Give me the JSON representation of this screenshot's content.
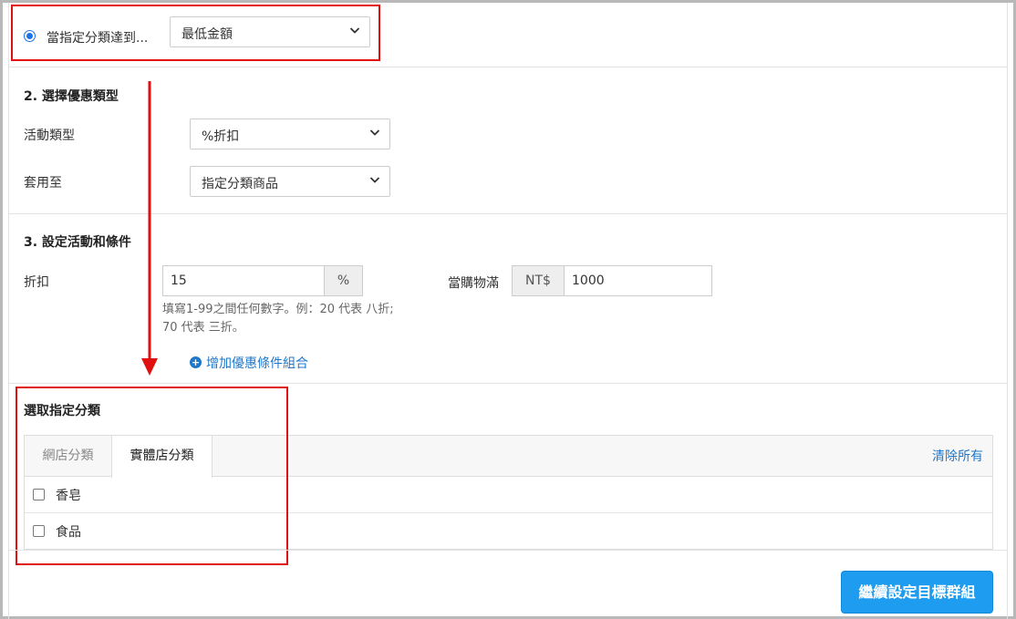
{
  "condition": {
    "radio_label": "當指定分類達到...",
    "select_value": "最低金額"
  },
  "section2": {
    "title": "2. 選擇優惠類型",
    "activity_type_label": "活動類型",
    "activity_type_value": "%折扣",
    "apply_to_label": "套用至",
    "apply_to_value": "指定分類商品"
  },
  "section3": {
    "title": "3. 設定活動和條件",
    "discount_label": "折扣",
    "discount_value": "15",
    "discount_unit": "%",
    "hint_line1": "填寫1-99之間任何數字。例：20 代表 八折;",
    "hint_line2": "70 代表 三折。",
    "threshold_label": "當購物滿",
    "currency": "NT$",
    "threshold_value": "1000",
    "add_condition_link": "增加優惠條件組合"
  },
  "category": {
    "title": "選取指定分類",
    "tabs": [
      "網店分類",
      "實體店分類"
    ],
    "clear_all": "清除所有",
    "items": [
      "香皂",
      "食品"
    ]
  },
  "footer": {
    "continue_button": "繼續設定目標群組"
  },
  "colors": {
    "accent": "#1e9cf0",
    "link": "#1f77c9",
    "annotation_red": "#e01010"
  }
}
